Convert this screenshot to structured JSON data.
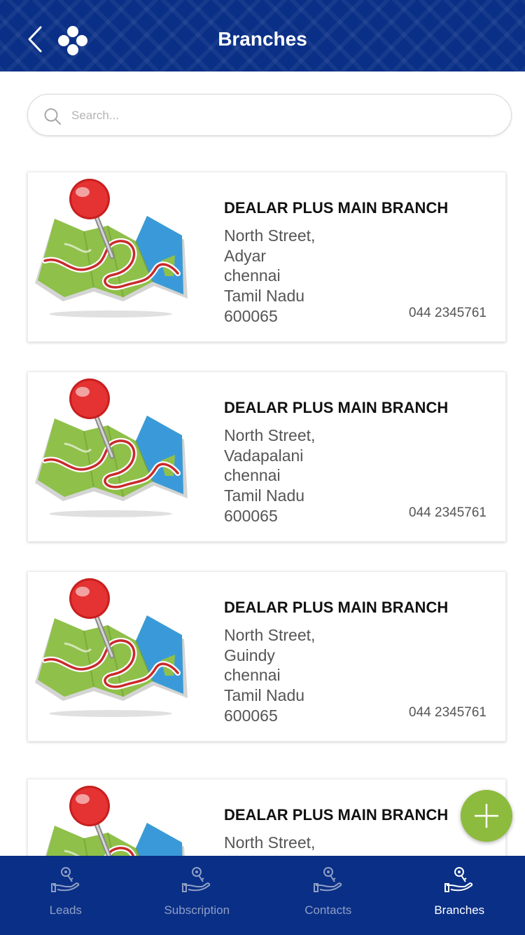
{
  "header": {
    "title": "Branches",
    "back_icon": "chevron-left-icon",
    "logo_icon": "clover-logo-icon"
  },
  "search": {
    "placeholder": "Search...",
    "value": ""
  },
  "branches": [
    {
      "name": "DEALAR PLUS MAIN BRANCH",
      "street": "North Street,",
      "area": "Adyar",
      "city": "chennai",
      "state": "Tamil Nadu",
      "pincode": "600065",
      "phone": "044 2345761"
    },
    {
      "name": "DEALAR PLUS MAIN BRANCH",
      "street": "North Street,",
      "area": "Vadapalani",
      "city": "chennai",
      "state": "Tamil Nadu",
      "pincode": "600065",
      "phone": "044 2345761"
    },
    {
      "name": "DEALAR PLUS MAIN BRANCH",
      "street": "North Street,",
      "area": "Guindy",
      "city": "chennai",
      "state": "Tamil Nadu",
      "pincode": "600065",
      "phone": "044 2345761"
    },
    {
      "name": "DEALAR PLUS MAIN BRANCH",
      "street": "North Street,",
      "area": "",
      "city": "",
      "state": "",
      "pincode": "",
      "phone": ""
    }
  ],
  "fab": {
    "icon": "plus-icon",
    "color": "#8dbb3e"
  },
  "tabs": [
    {
      "label": "Leads",
      "icon": "hand-key-icon",
      "active": false
    },
    {
      "label": "Subscription",
      "icon": "hand-key-icon",
      "active": false
    },
    {
      "label": "Contacts",
      "icon": "hand-key-icon",
      "active": false
    },
    {
      "label": "Branches",
      "icon": "hand-key-icon",
      "active": true
    }
  ],
  "colors": {
    "brand": "#0a2f86",
    "accent": "#8dbb3e",
    "tab_inactive": "#8f9fc6"
  }
}
